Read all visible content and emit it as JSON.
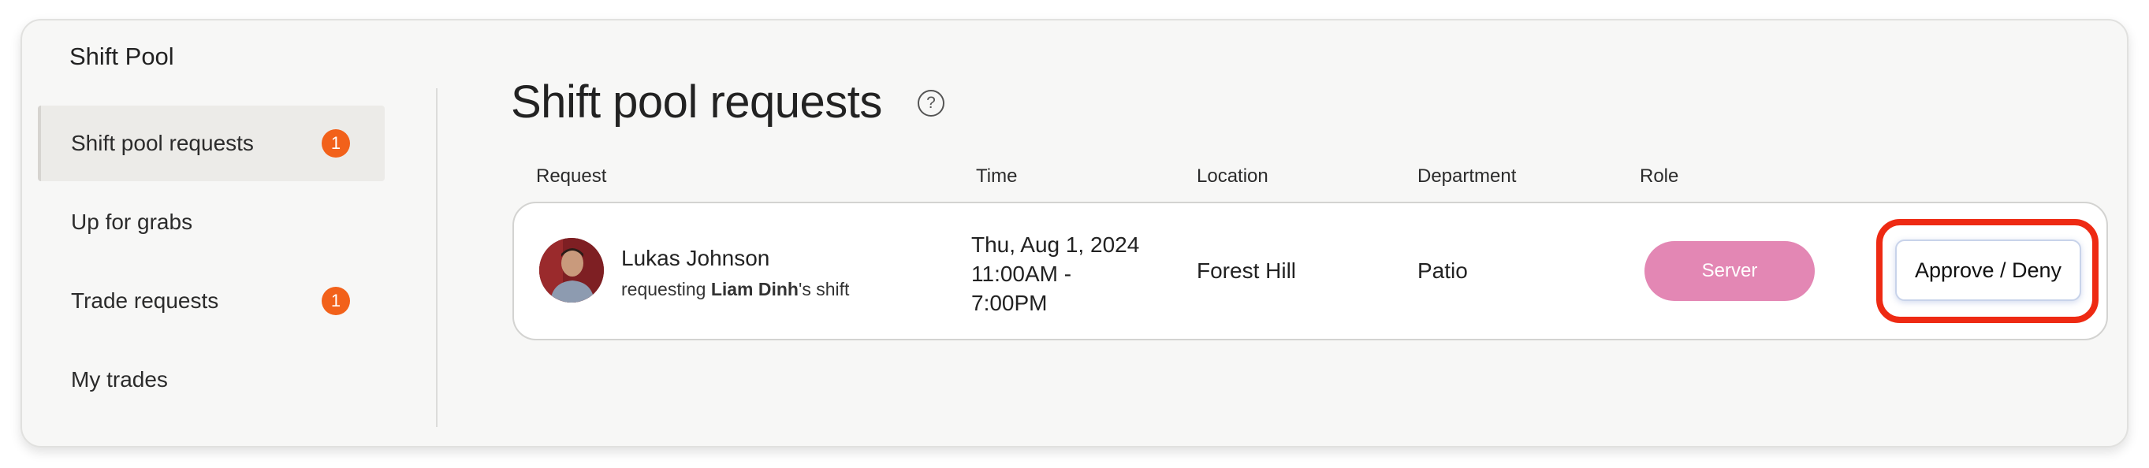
{
  "app_title": "Shift Pool",
  "sidebar": {
    "items": [
      {
        "label": "Shift pool requests",
        "badge": "1"
      },
      {
        "label": "Up for grabs"
      },
      {
        "label": "Trade requests",
        "badge": "1"
      },
      {
        "label": "My trades"
      }
    ]
  },
  "main": {
    "title": "Shift pool requests",
    "help_icon_glyph": "?",
    "columns": [
      "Request",
      "Time",
      "Location",
      "Department",
      "Role"
    ],
    "rows": [
      {
        "name": "Lukas Johnson",
        "request_prefix": "requesting ",
        "request_person": "Liam Dinh",
        "request_suffix": "'s shift",
        "time_line1": "Thu, Aug 1, 2024",
        "time_line2": "11:00AM -",
        "time_line3": "7:00PM",
        "location": "Forest Hill",
        "department": "Patio",
        "role": "Server",
        "action_label": "Approve / Deny"
      }
    ]
  },
  "colors": {
    "badge": "#f2611a",
    "role_pill": "#e387b4",
    "highlight_ring": "#ee2a13"
  },
  "icons": {
    "help": "question-circle-icon",
    "avatar": "user-photo"
  }
}
